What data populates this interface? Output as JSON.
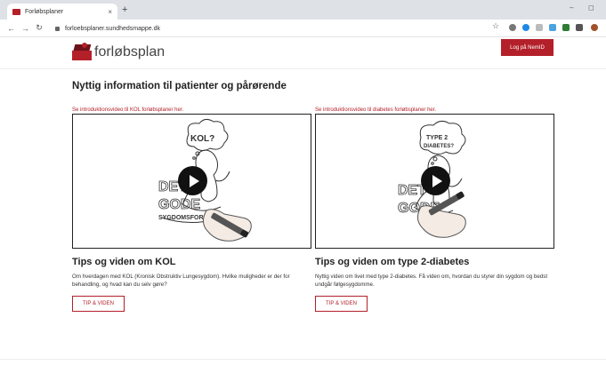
{
  "browser": {
    "tab_title": "Forløbsplaner",
    "tab_close": "×",
    "new_tab": "+",
    "url": "forloebsplaner.sundhedsmappe.dk"
  },
  "header": {
    "logo_text": "forløbsplan",
    "login_label": "Log på NemID"
  },
  "main": {
    "title": "Nyttig information til patienter og pårørende",
    "cards": [
      {
        "video_caption": "Se introduktionsvideo til KOL forløbsplaner her.",
        "bubble_text": "KOL?",
        "board_text": [
          "DET",
          "GODE",
          "SYGDOMSFORL"
        ],
        "title": "Tips og viden om KOL",
        "description": "Om hverdagen med KOL (Kronisk Obstruktiv Lungesygdom). Hvilke muligheder er der for behandling, og hvad kan du selv gøre?",
        "button_label": "TIP & VIDEN"
      },
      {
        "video_caption": "Se introduktionsvideo til diabetes forløbsplaner her.",
        "bubble_text": [
          "TYPE 2",
          "DIABETES?"
        ],
        "board_text": [
          "DET",
          "GODE"
        ],
        "title": "Tips og viden om type 2-diabetes",
        "description": "Nyttig viden om livet med type 2-diabetes. Få viden om, hvordan du styrer din sygdom og bedst undgår følgesygdomme.",
        "button_label": "TIP & VIDEN"
      }
    ]
  },
  "colors": {
    "brand": "#b3202a",
    "brand_dark": "#6d1219"
  }
}
